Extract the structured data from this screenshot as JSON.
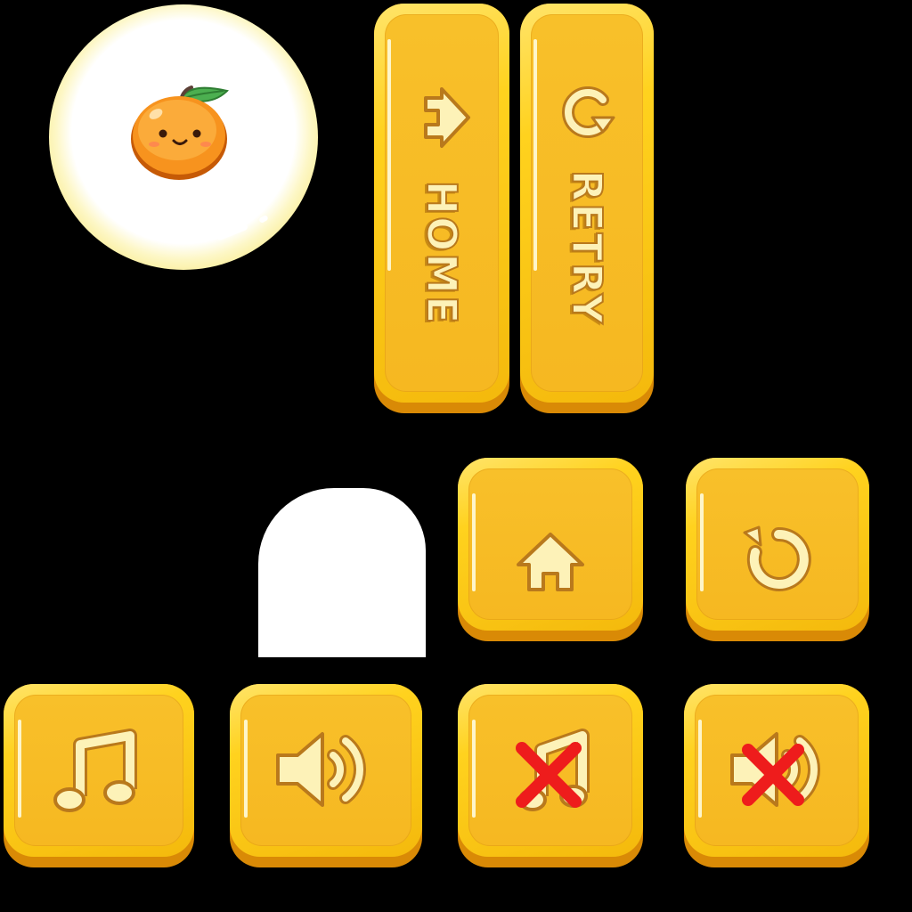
{
  "character": {
    "icon": "orange-fruit-icon"
  },
  "tall_buttons": {
    "home": {
      "label": "HOME",
      "icon": "home-icon"
    },
    "retry": {
      "label": "RETRY",
      "icon": "retry-icon"
    }
  },
  "square_buttons": [
    {
      "id": "home",
      "icon": "home-icon"
    },
    {
      "id": "retry",
      "icon": "retry-icon"
    },
    {
      "id": "music",
      "icon": "music-note-icon"
    },
    {
      "id": "sound",
      "icon": "speaker-icon"
    },
    {
      "id": "music-off",
      "icon": "music-off-icon"
    },
    {
      "id": "sound-off",
      "icon": "sound-off-icon"
    }
  ],
  "colors": {
    "button_face": "#f6b821",
    "button_rim": "#ffd21e",
    "button_shadow": "#d98a06",
    "icon_fill": "#fdf2b8",
    "mute_cross": "#ee1c1c",
    "background": "#000000"
  }
}
